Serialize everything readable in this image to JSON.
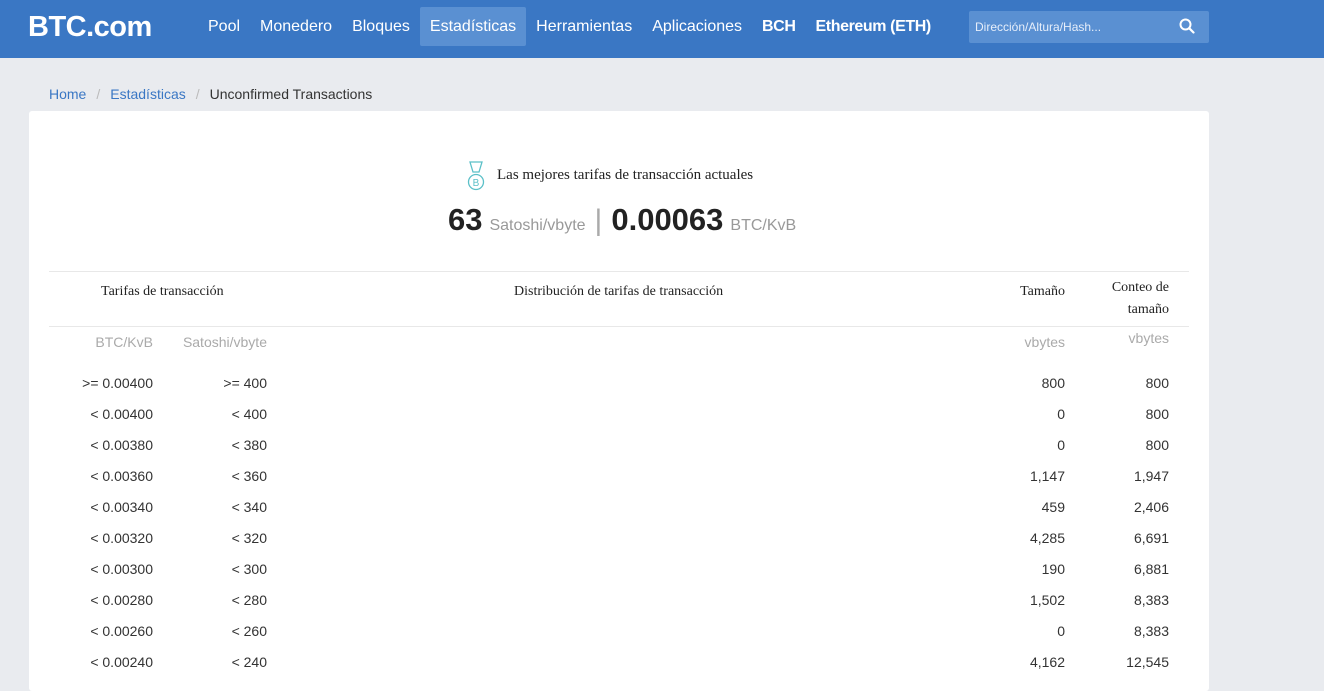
{
  "nav": {
    "logo": "BTC.com",
    "items": [
      {
        "label": "Pool"
      },
      {
        "label": "Monedero"
      },
      {
        "label": "Bloques"
      },
      {
        "label": "Estadísticas"
      },
      {
        "label": "Herramientas"
      },
      {
        "label": "Aplicaciones"
      },
      {
        "label": "BCH"
      },
      {
        "label": "Ethereum (ETH)"
      }
    ],
    "active_item": "Estadísticas",
    "search_placeholder": "Dirección/Altura/Hash..."
  },
  "breadcrumb": {
    "home": "Home",
    "section": "Estadísticas",
    "current": "Unconfirmed Transactions",
    "separator": "/"
  },
  "best_fee": {
    "label": "Las mejores tarifas de transacción actuales",
    "sat_value": "63",
    "sat_unit": "Satoshi/vbyte",
    "divider": "|",
    "btc_value": "0.00063",
    "btc_unit": "BTC/KvB"
  },
  "table": {
    "headers": {
      "fees": "Tarifas de transacción",
      "distribution": "Distribución de tarifas de transacción",
      "size": "Tamaño",
      "count_line1": "Conteo de",
      "count_line2": "tamaño"
    },
    "subheaders": {
      "btc": "BTC/KvB",
      "sat": "Satoshi/vbyte",
      "size": "vbytes",
      "count": "vbytes"
    },
    "rows": [
      {
        "btc": ">= 0.00400",
        "sat": ">= 400",
        "size": "800",
        "count": "800"
      },
      {
        "btc": "< 0.00400",
        "sat": "< 400",
        "size": "0",
        "count": "800"
      },
      {
        "btc": "< 0.00380",
        "sat": "< 380",
        "size": "0",
        "count": "800"
      },
      {
        "btc": "< 0.00360",
        "sat": "< 360",
        "size": "1,147",
        "count": "1,947"
      },
      {
        "btc": "< 0.00340",
        "sat": "< 340",
        "size": "459",
        "count": "2,406"
      },
      {
        "btc": "< 0.00320",
        "sat": "< 320",
        "size": "4,285",
        "count": "6,691"
      },
      {
        "btc": "< 0.00300",
        "sat": "< 300",
        "size": "190",
        "count": "6,881"
      },
      {
        "btc": "< 0.00280",
        "sat": "< 280",
        "size": "1,502",
        "count": "8,383"
      },
      {
        "btc": "< 0.00260",
        "sat": "< 260",
        "size": "0",
        "count": "8,383"
      },
      {
        "btc": "< 0.00240",
        "sat": "< 240",
        "size": "4,162",
        "count": "12,545"
      }
    ]
  },
  "colors": {
    "navbar": "#3a77c4",
    "active_nav": "#5a90d2",
    "link": "#3a77c4",
    "medal": "#5bc0c8"
  }
}
